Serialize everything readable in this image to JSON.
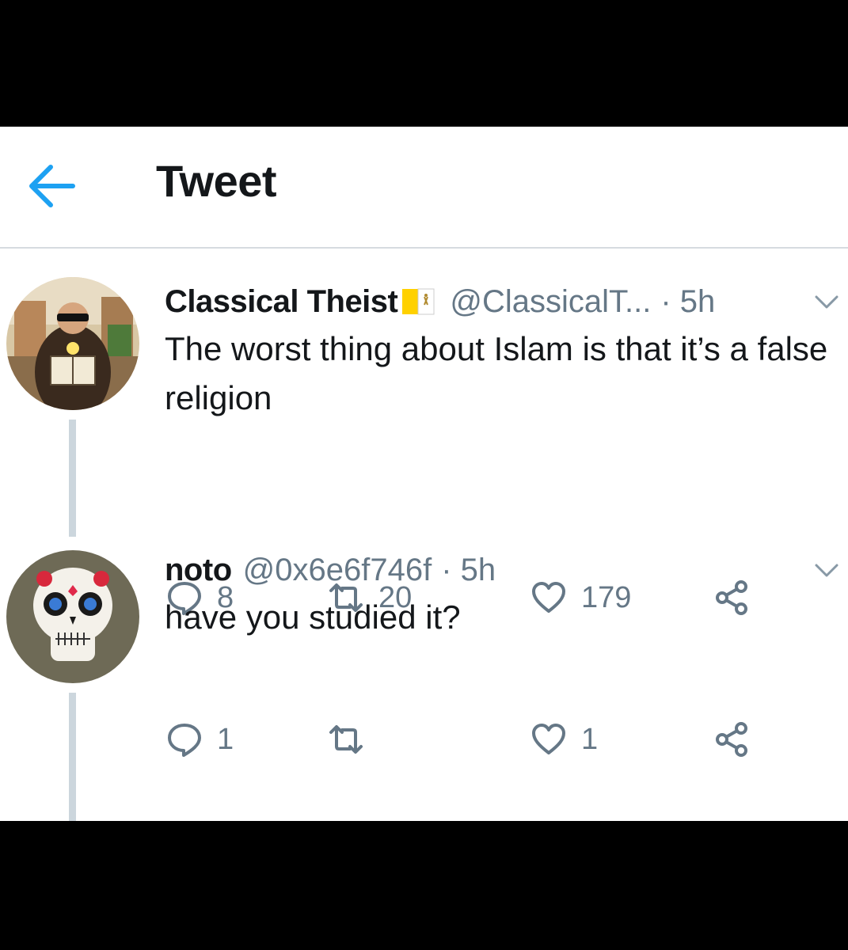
{
  "header": {
    "title": "Tweet",
    "back_icon": "arrow-left-icon"
  },
  "tweets": [
    {
      "name": "Classical Theist",
      "handle": "@ClassicalT...",
      "time": "· 5h",
      "text": "The worst thing about Islam is that it’s a false religion",
      "reply_count": "8",
      "retweet_count": "20",
      "like_count": "179",
      "flag_icon": "vatican-flag-icon"
    },
    {
      "name": "noto",
      "handle": "@0x6e6f746f",
      "time": "· 5h",
      "text": "have you studied it?",
      "reply_count": "1",
      "retweet_count": "",
      "like_count": "1"
    }
  ],
  "colors": {
    "accent": "#1da1f2",
    "text": "#14171a",
    "secondary": "#657786",
    "thread": "#ccd6dd"
  }
}
